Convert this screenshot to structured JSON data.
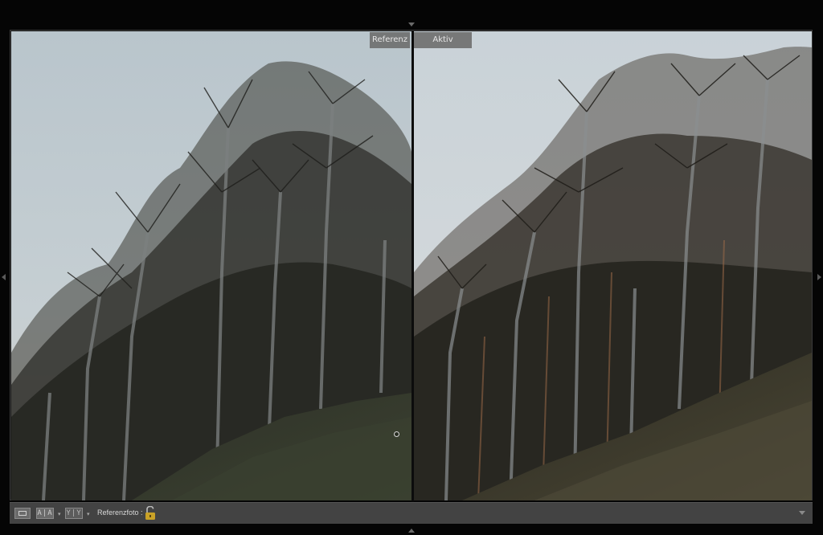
{
  "compare": {
    "reference_label": "Referenz",
    "active_label": "Aktiv"
  },
  "toolbar": {
    "loupe_icon": "single-view-icon",
    "before_after_label": "A|A",
    "swap_label": "Y|Y",
    "reference_photo_label": "Referenzfoto :",
    "lock_icon": "unlocked-padlock-icon"
  },
  "colors": {
    "background": "#050505",
    "toolbar": "#434343",
    "lock_accent": "#c9a227"
  }
}
